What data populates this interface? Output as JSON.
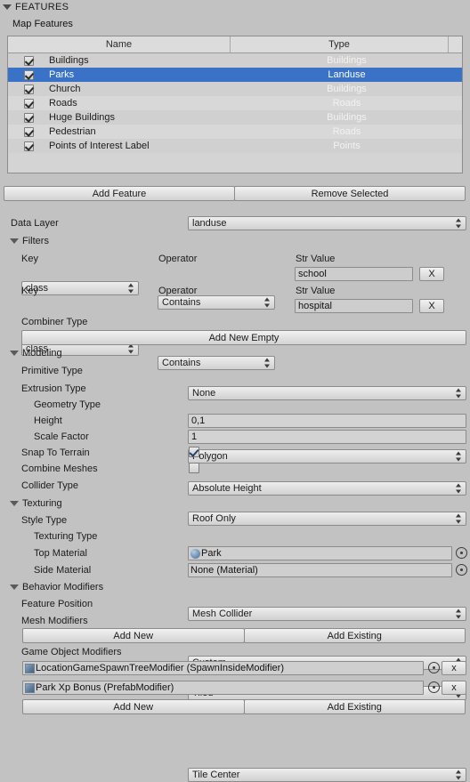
{
  "header": {
    "features_title": "FEATURES",
    "map_features_label": "Map Features"
  },
  "table": {
    "columns": [
      "Name",
      "Type"
    ],
    "rows": [
      {
        "checked": true,
        "name": "Buildings",
        "type": "Buildings",
        "selected": false
      },
      {
        "checked": true,
        "name": "Parks",
        "type": "Landuse",
        "selected": true
      },
      {
        "checked": true,
        "name": "Church",
        "type": "Buildings",
        "selected": false
      },
      {
        "checked": true,
        "name": "Roads",
        "type": "Roads",
        "selected": false
      },
      {
        "checked": true,
        "name": "Huge Buildings",
        "type": "Buildings",
        "selected": false
      },
      {
        "checked": true,
        "name": "Pedestrian",
        "type": "Roads",
        "selected": false
      },
      {
        "checked": true,
        "name": "Points of Interest Label",
        "type": "Points",
        "selected": false
      }
    ]
  },
  "feature_buttons": {
    "add_feature": "Add Feature",
    "remove_selected": "Remove Selected"
  },
  "data_layer": {
    "label": "Data Layer",
    "value": "landuse"
  },
  "filters": {
    "section_label": "Filters",
    "key_label": "Key",
    "operator_label": "Operator",
    "str_value_label": "Str Value",
    "remove_label": "X",
    "entries": [
      {
        "key": "class",
        "operator": "Contains",
        "value": "school"
      },
      {
        "key": "class",
        "operator": "Contains",
        "value": "hospital"
      }
    ],
    "combiner_label": "Combiner Type",
    "combiner_value": "None",
    "add_new_empty": "Add New Empty"
  },
  "modeling": {
    "section_label": "Modeling",
    "primitive_type_label": "Primitive Type",
    "primitive_type_value": "Polygon",
    "extrusion_type_label": "Extrusion Type",
    "extrusion_type_value": "Absolute Height",
    "geometry_type_label": "Geometry Type",
    "geometry_type_value": "Roof Only",
    "height_label": "Height",
    "height_value": "0,1",
    "scale_factor_label": "Scale Factor",
    "scale_factor_value": "1",
    "snap_to_terrain_label": "Snap To Terrain",
    "snap_to_terrain_checked": true,
    "combine_meshes_label": "Combine Meshes",
    "combine_meshes_checked": false,
    "collider_type_label": "Collider Type",
    "collider_type_value": "Mesh Collider"
  },
  "texturing": {
    "section_label": "Texturing",
    "style_type_label": "Style Type",
    "style_type_value": "Custom",
    "texturing_type_label": "Texturing Type",
    "texturing_type_value": "Tiled",
    "top_material_label": "Top Material",
    "top_material_value": "Park",
    "side_material_label": "Side Material",
    "side_material_value": "None (Material)"
  },
  "behavior_modifiers": {
    "section_label": "Behavior Modifiers",
    "feature_position_label": "Feature Position",
    "feature_position_value": "Tile Center",
    "mesh_modifiers_label": "Mesh Modifiers",
    "mesh_add_new": "Add New",
    "mesh_add_existing": "Add Existing",
    "game_object_modifiers_label": "Game Object Modifiers",
    "game_object_modifiers": [
      {
        "value": "LocationGameSpawnTreeModifier (SpawnInsideModifier)",
        "remove_label": "x"
      },
      {
        "value": "Park Xp Bonus (PrefabModifier)",
        "remove_label": "x"
      }
    ],
    "gom_add_new": "Add New",
    "gom_add_existing": "Add Existing"
  },
  "colors": {
    "background": "#c2c2c2",
    "selection": "#3a72c8",
    "row_odd": "#d0d0d0",
    "row_even": "#d8d8d8",
    "text": "#1b1b1b"
  }
}
